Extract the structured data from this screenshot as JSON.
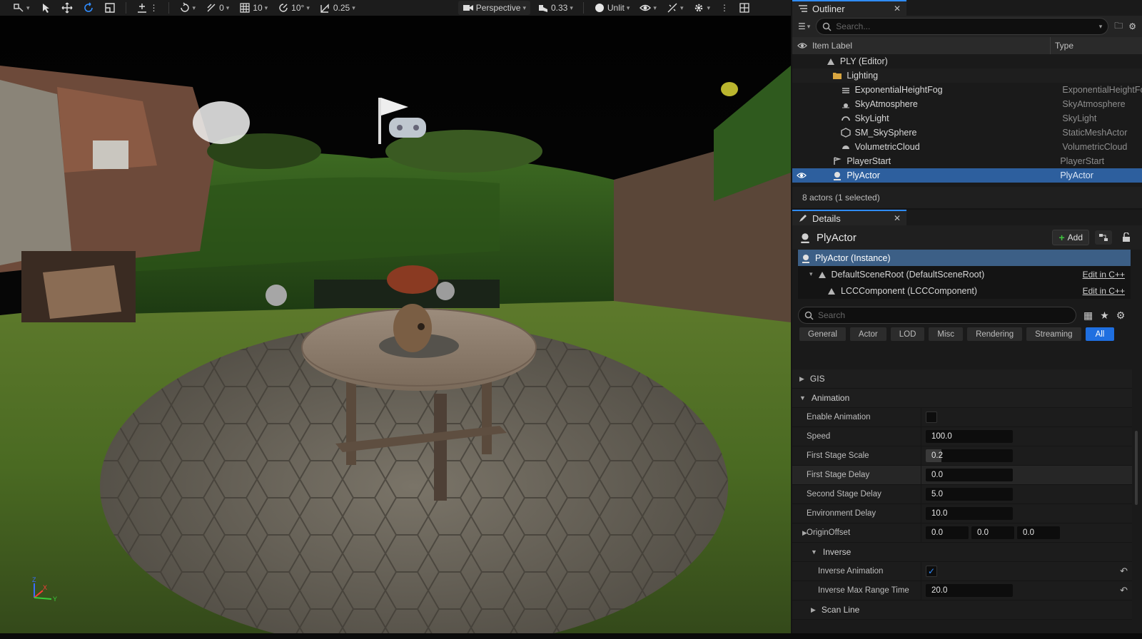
{
  "viewport": {
    "toolbar": {
      "rotation_snap_value": "0",
      "grid_snap_value": "10",
      "angle_snap_value": "10°",
      "scale_snap_value": "0.25",
      "view_mode_label": "Perspective",
      "camera_speed_value": "0.33",
      "lighting_mode_label": "Unlit"
    }
  },
  "outliner": {
    "tab_label": "Outliner",
    "search_placeholder": "Search...",
    "columns": {
      "label": "Item Label",
      "type": "Type"
    },
    "rows": [
      {
        "label": "PLY (Editor)",
        "type": ""
      },
      {
        "label": "Lighting",
        "type": ""
      },
      {
        "label": "ExponentialHeightFog",
        "type": "ExponentialHeightFog"
      },
      {
        "label": "SkyAtmosphere",
        "type": "SkyAtmosphere"
      },
      {
        "label": "SkyLight",
        "type": "SkyLight"
      },
      {
        "label": "SM_SkySphere",
        "type": "StaticMeshActor"
      },
      {
        "label": "VolumetricCloud",
        "type": "VolumetricCloud"
      },
      {
        "label": "PlayerStart",
        "type": "PlayerStart"
      },
      {
        "label": "PlyActor",
        "type": "PlyActor"
      }
    ],
    "status": "8 actors (1 selected)"
  },
  "details": {
    "tab_label": "Details",
    "actor_name": "PlyActor",
    "add_label": "Add",
    "components": [
      {
        "label": "PlyActor (Instance)",
        "edit": ""
      },
      {
        "label": "DefaultSceneRoot (DefaultSceneRoot)",
        "edit": "Edit in C++"
      },
      {
        "label": "LCCComponent (LCCComponent)",
        "edit": "Edit in C++"
      }
    ],
    "search_placeholder": "Search",
    "filters": [
      "General",
      "Actor",
      "LOD",
      "Misc",
      "Rendering",
      "Streaming",
      "All"
    ],
    "categories": {
      "gis": "GIS",
      "animation": "Animation",
      "inverse": "Inverse",
      "scan_line": "Scan Line"
    },
    "props": {
      "enable_animation": {
        "label": "Enable Animation",
        "checked": false
      },
      "speed": {
        "label": "Speed",
        "value": "100.0"
      },
      "first_stage_scale": {
        "label": "First Stage Scale",
        "value": "0.2"
      },
      "first_stage_delay": {
        "label": "First Stage Delay",
        "value": "0.0"
      },
      "second_stage_delay": {
        "label": "Second Stage Delay",
        "value": "5.0"
      },
      "environment_delay": {
        "label": "Environment Delay",
        "value": "10.0"
      },
      "origin_offset": {
        "label": "OriginOffset",
        "x": "0.0",
        "y": "0.0",
        "z": "0.0"
      },
      "inverse_animation": {
        "label": "Inverse Animation",
        "checked": true
      },
      "inverse_max_range_time": {
        "label": "Inverse Max Range Time",
        "value": "20.0"
      }
    }
  },
  "colors": {
    "accent": "#2f8cff",
    "selection": "#2d5f9e",
    "panel_bg": "#1a1a1a"
  }
}
